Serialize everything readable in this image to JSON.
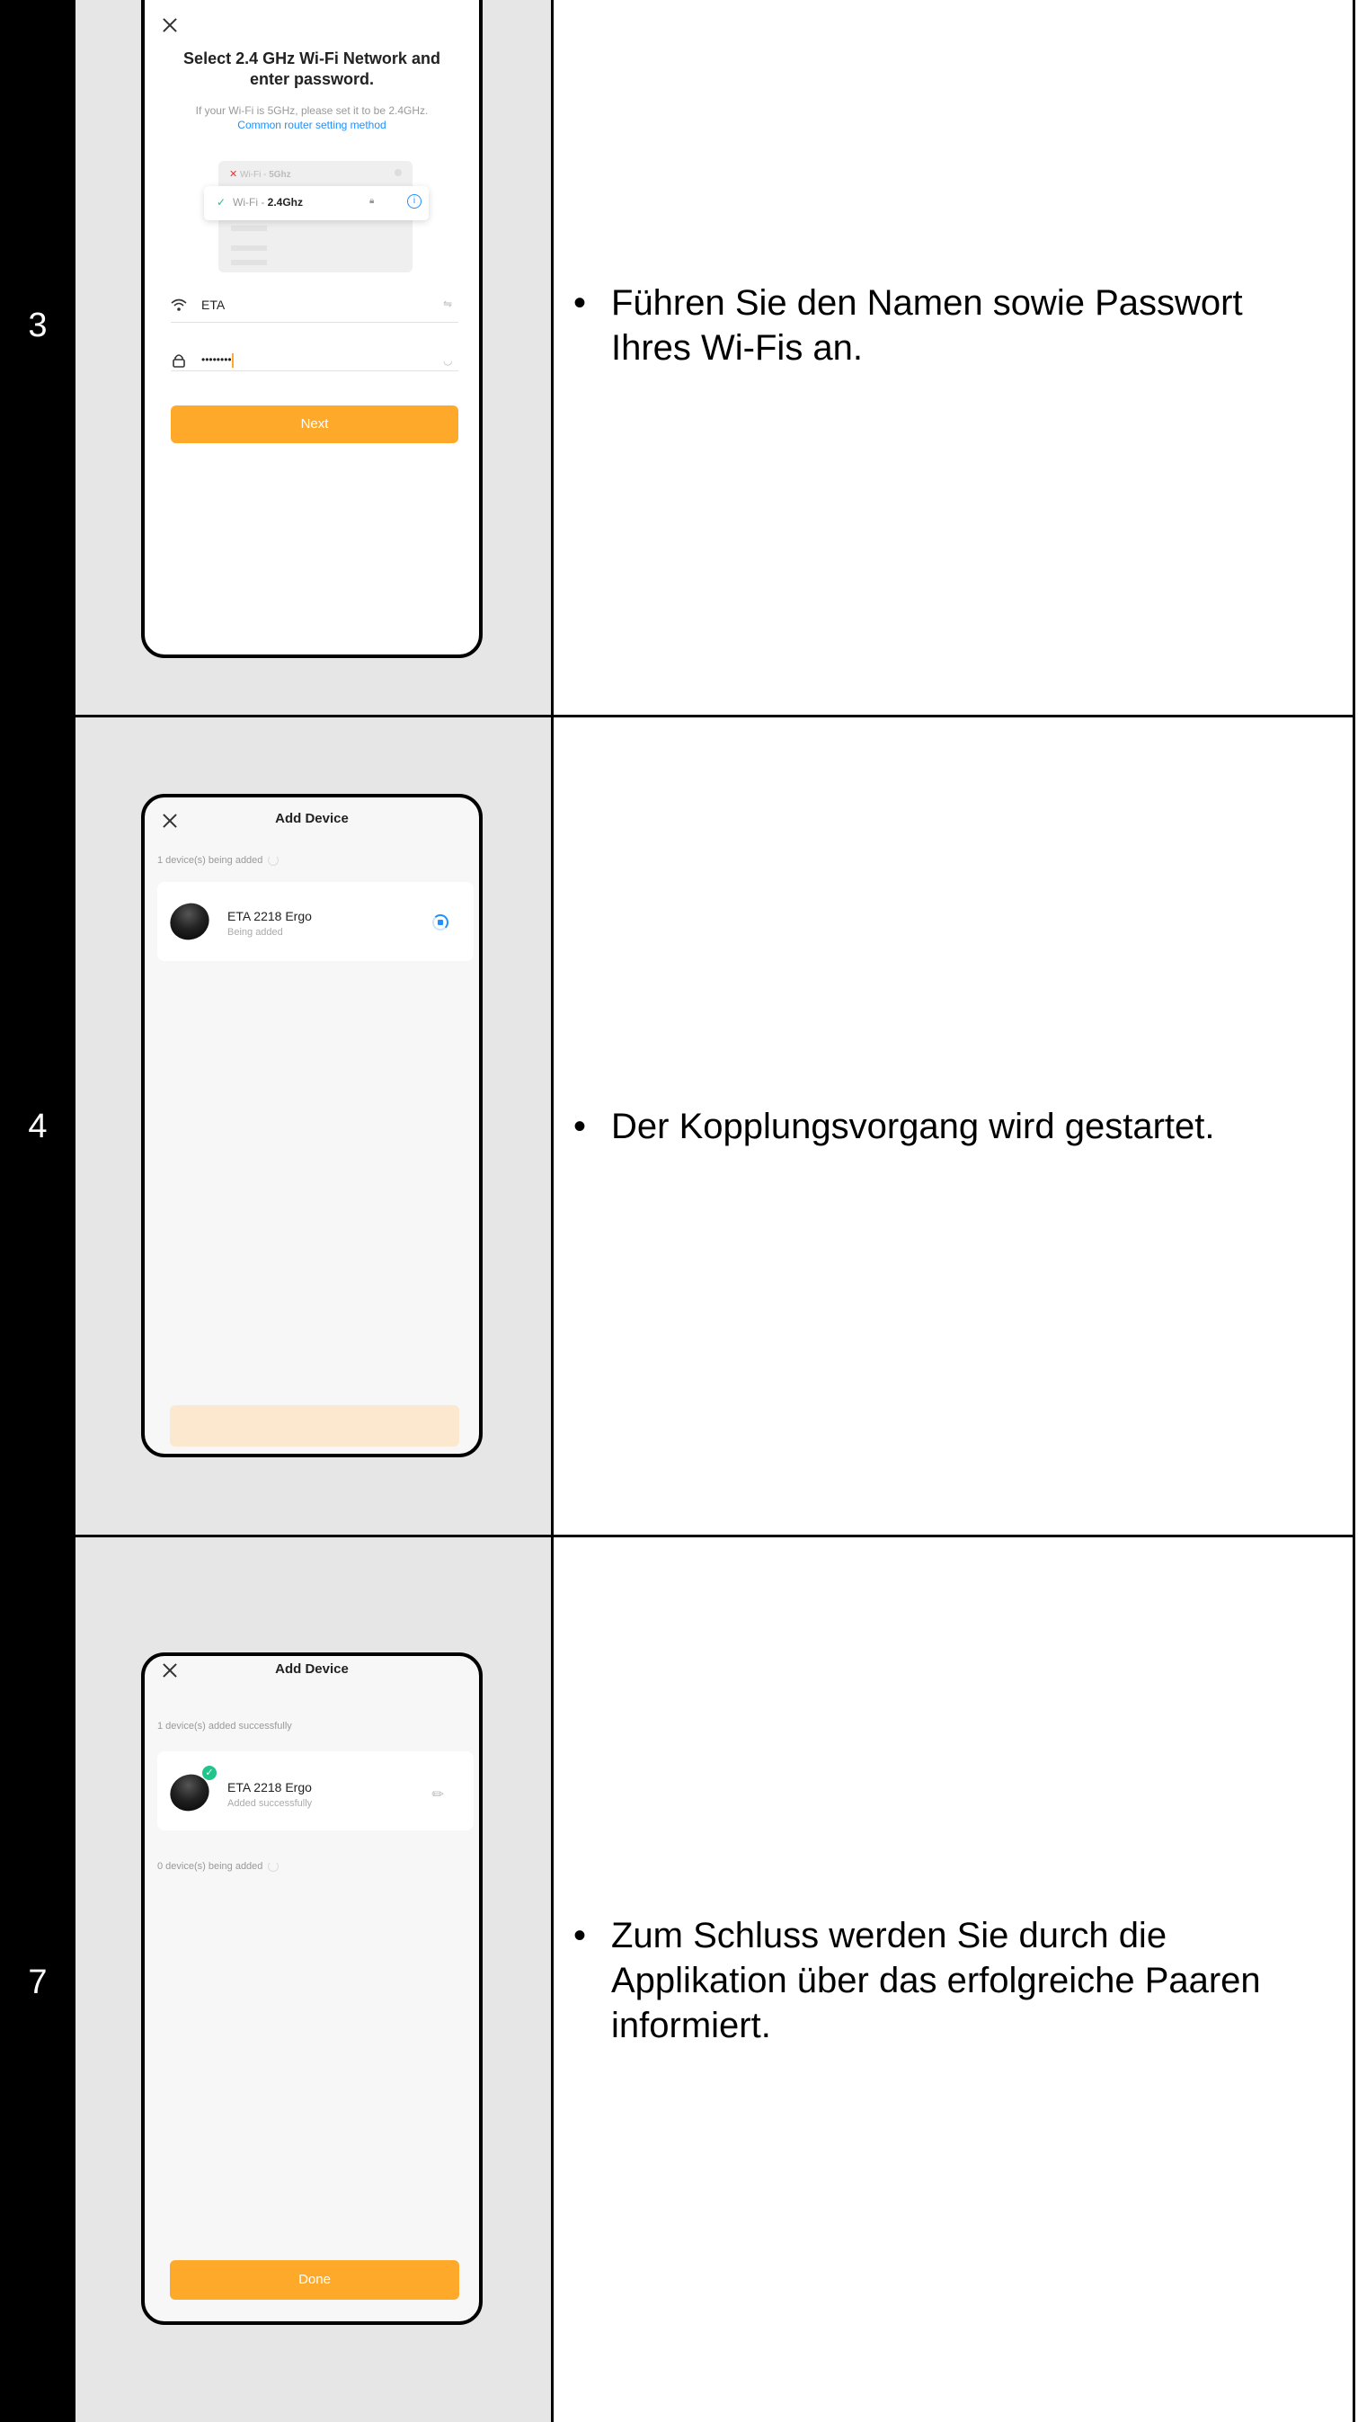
{
  "steps": [
    {
      "number": "3",
      "text": "Führen Sie den Namen sowie Passwort Ihres Wi-Fis an.",
      "phone": {
        "title": "Select 2.4 GHz Wi-Fi Network and enter password.",
        "hint": "If your Wi-Fi is 5GHz, please set it to be 2.4GHz.",
        "link": "Common router setting method",
        "wifi_bad_prefix": "Wi-Fi - ",
        "wifi_bad_band": "5Ghz",
        "wifi_good_prefix": "Wi-Fi - ",
        "wifi_good_band": "2.4Ghz",
        "ssid_value": "ETA",
        "password_value": "••••••••",
        "button_label": "Next"
      }
    },
    {
      "number": "4",
      "text": "Der Kopplungsvorgang wird gestartet.",
      "phone": {
        "title": "Add Device",
        "status": "1 device(s) being added",
        "device_name": "ETA 2218 Ergo",
        "device_status": "Being added"
      }
    },
    {
      "number": "7",
      "text": "Zum Schluss werden Sie durch die Applikation über das erfolgreiche Paaren informiert.",
      "phone": {
        "title": "Add Device",
        "status_success": "1 device(s) added successfully",
        "device_name": "ETA 2218 Ergo",
        "device_status": "Added successfully",
        "status_pending": "0 device(s) being added",
        "button_label": "Done"
      }
    }
  ],
  "colors": {
    "accent": "#ffa92b",
    "accent_faded": "#fbe8cf",
    "link": "#1e90ff",
    "success": "#1fc58a"
  }
}
